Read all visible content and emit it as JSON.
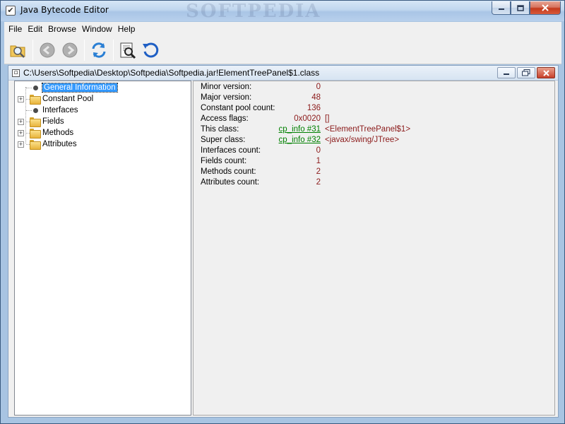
{
  "window": {
    "title": "Java Bytecode Editor",
    "watermark": "SOFTPEDIA",
    "minimize_icon": "minimize-icon",
    "maximize_icon": "maximize-icon",
    "close_icon": "close-icon"
  },
  "menu": {
    "items": [
      "File",
      "Edit",
      "Browse",
      "Window",
      "Help"
    ]
  },
  "toolbar": {
    "icons": [
      "open-folder-icon",
      "back-arrow-icon",
      "forward-arrow-icon",
      "refresh-icon",
      "find-icon",
      "reload-icon"
    ]
  },
  "internal_frame": {
    "title": "C:\\Users\\Softpedia\\Desktop\\Softpedia\\Softpedia.jar!ElementTreePanel$1.class"
  },
  "tree": {
    "items": [
      {
        "label": "General Information",
        "type": "leaf",
        "selected": true
      },
      {
        "label": "Constant Pool",
        "type": "folder",
        "selected": false
      },
      {
        "label": "Interfaces",
        "type": "leaf",
        "selected": false
      },
      {
        "label": "Fields",
        "type": "folder",
        "selected": false
      },
      {
        "label": "Methods",
        "type": "folder",
        "selected": false
      },
      {
        "label": "Attributes",
        "type": "folder",
        "selected": false
      }
    ]
  },
  "info": {
    "rows": [
      {
        "label": "Minor version:",
        "value": "0",
        "extra": ""
      },
      {
        "label": "Major version:",
        "value": "48",
        "extra": ""
      },
      {
        "label": "Constant pool count:",
        "value": "136",
        "extra": ""
      },
      {
        "label": "Access flags:",
        "value": "0x0020",
        "extra": "[]"
      },
      {
        "label": "This class:",
        "value": "cp_info #31",
        "extra": "<ElementTreePanel$1>",
        "link": true
      },
      {
        "label": "Super class:",
        "value": "cp_info #32",
        "extra": "<javax/swing/JTree>",
        "link": true
      },
      {
        "label": "Interfaces count:",
        "value": "0",
        "extra": ""
      },
      {
        "label": "Fields count:",
        "value": "1",
        "extra": ""
      },
      {
        "label": "Methods count:",
        "value": "2",
        "extra": ""
      },
      {
        "label": "Attributes count:",
        "value": "2",
        "extra": ""
      }
    ]
  },
  "colors": {
    "value_text": "#8b1a1a",
    "link_text": "#008000",
    "selection": "#3399ff"
  }
}
